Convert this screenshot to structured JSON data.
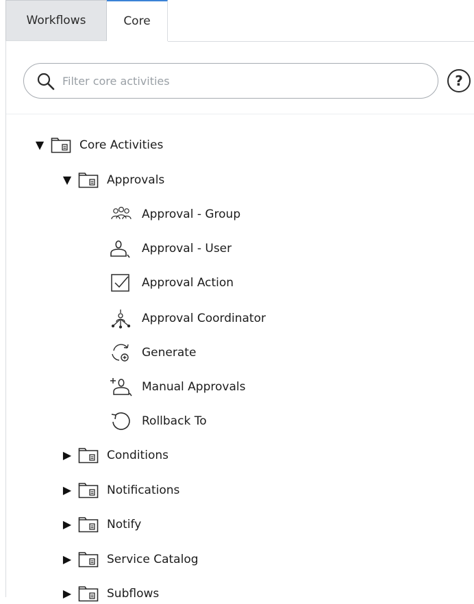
{
  "tabs": [
    {
      "label": "Workflows",
      "active": false
    },
    {
      "label": "Core",
      "active": true
    }
  ],
  "filter": {
    "placeholder": "Filter core activities",
    "value": ""
  },
  "help": {
    "icon": "help-icon"
  },
  "tree": {
    "root": {
      "label": "Core Activities",
      "expanded": true,
      "icon": "folder-icon"
    },
    "approvals": {
      "label": "Approvals",
      "expanded": true,
      "icon": "folder-icon",
      "items": [
        {
          "label": "Approval - Group",
          "icon": "group-icon"
        },
        {
          "label": "Approval - User",
          "icon": "user-icon"
        },
        {
          "label": "Approval Action",
          "icon": "checkbox-icon"
        },
        {
          "label": "Approval Coordinator",
          "icon": "coordinator-icon"
        },
        {
          "label": "Generate",
          "icon": "generate-icon"
        },
        {
          "label": "Manual Approvals",
          "icon": "add-user-icon"
        },
        {
          "label": "Rollback To",
          "icon": "rollback-icon"
        }
      ]
    },
    "folders": [
      {
        "label": "Conditions",
        "expanded": false
      },
      {
        "label": "Notifications",
        "expanded": false
      },
      {
        "label": "Notify",
        "expanded": false
      },
      {
        "label": "Service Catalog",
        "expanded": false
      },
      {
        "label": "Subflows",
        "expanded": false
      }
    ]
  },
  "colors": {
    "active_tab_accent": "#3b82d6",
    "inactive_tab_bg": "#e3e5e8",
    "border": "#d9dce0"
  }
}
